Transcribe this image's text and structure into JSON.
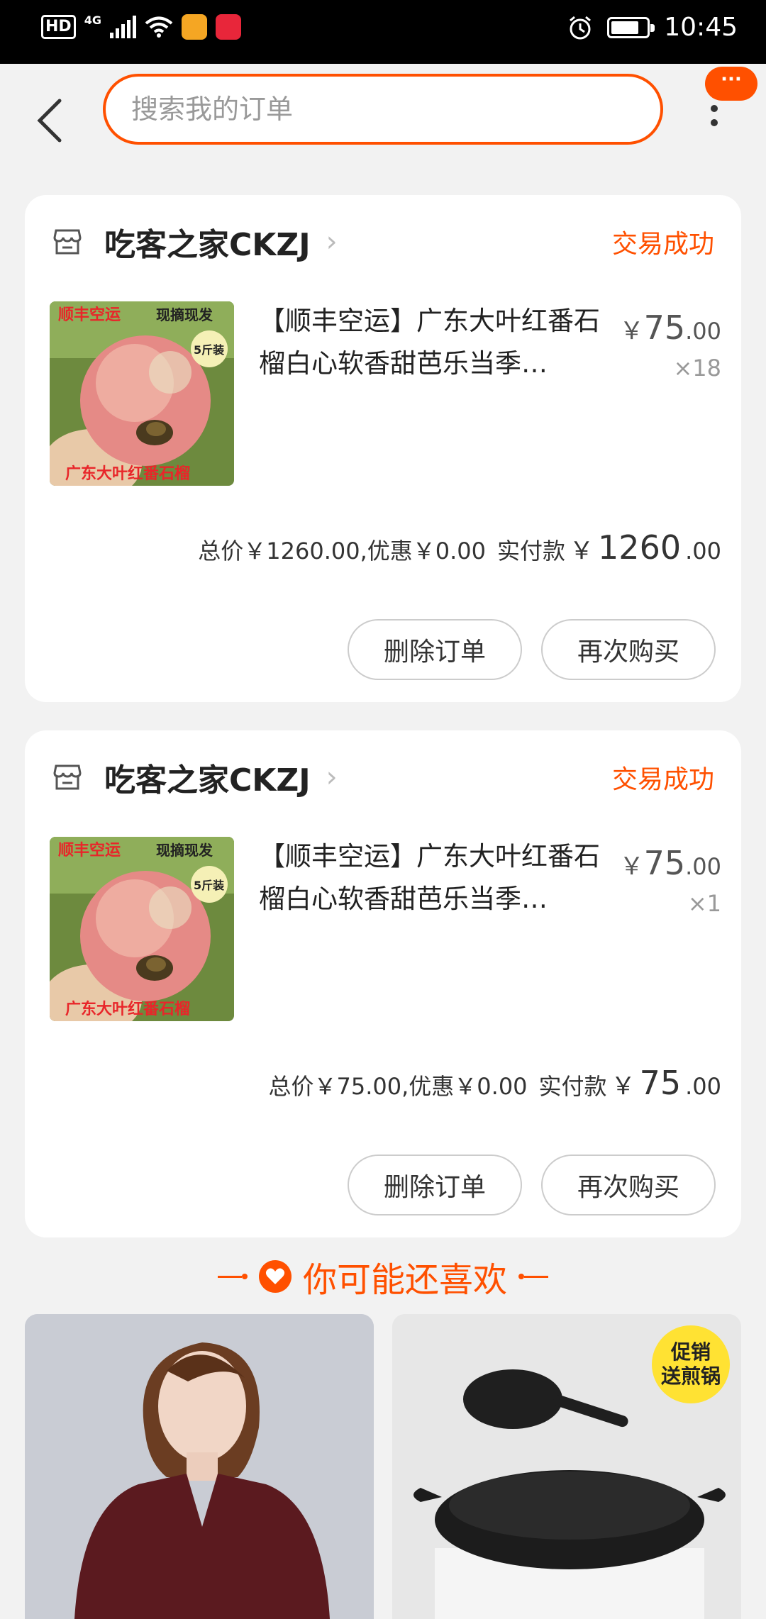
{
  "status_bar": {
    "hd": "HD",
    "network": "4G",
    "time": "10:45",
    "battery_level": 0.8
  },
  "header": {
    "search_placeholder": "搜索我的订单",
    "message_badge": "···"
  },
  "orders": [
    {
      "shop_name": "吃客之家CKZJ",
      "status": "交易成功",
      "product_title": "【顺丰空运】广东大叶红番石榴白心软香甜芭乐当季…",
      "image_labels": {
        "top_left": "顺丰空运",
        "top_right": "现摘现发",
        "pack": "5斤装",
        "bottom": "广东大叶红番石榴"
      },
      "price_yen": "￥",
      "price_int": "75",
      "price_dec": ".00",
      "qty": "×18",
      "summary": "总价￥1260.00,优惠￥0.00",
      "paid_label": "实付款",
      "paid_yen": "￥",
      "paid_int": "1260",
      "paid_dec": ".00",
      "delete_label": "删除订单",
      "rebuy_label": "再次购买"
    },
    {
      "shop_name": "吃客之家CKZJ",
      "status": "交易成功",
      "product_title": "【顺丰空运】广东大叶红番石榴白心软香甜芭乐当季…",
      "image_labels": {
        "top_left": "顺丰空运",
        "top_right": "现摘现发",
        "pack": "5斤装",
        "bottom": "广东大叶红番石榴"
      },
      "price_yen": "￥",
      "price_int": "75",
      "price_dec": ".00",
      "qty": "×1",
      "summary": "总价￥75.00,优惠￥0.00",
      "paid_label": "实付款",
      "paid_yen": "￥",
      "paid_int": "75",
      "paid_dec": ".00",
      "delete_label": "删除订单",
      "rebuy_label": "再次购买"
    }
  ],
  "recommend": {
    "title": "你可能还喜欢",
    "items": [
      {
        "icon": "sweater-photo"
      },
      {
        "icon": "pan-photo",
        "badge_line1": "促销",
        "badge_line2": "送煎锅"
      }
    ]
  },
  "colors": {
    "accent": "#ff5000",
    "background": "#f2f2f2",
    "card": "#ffffff"
  }
}
